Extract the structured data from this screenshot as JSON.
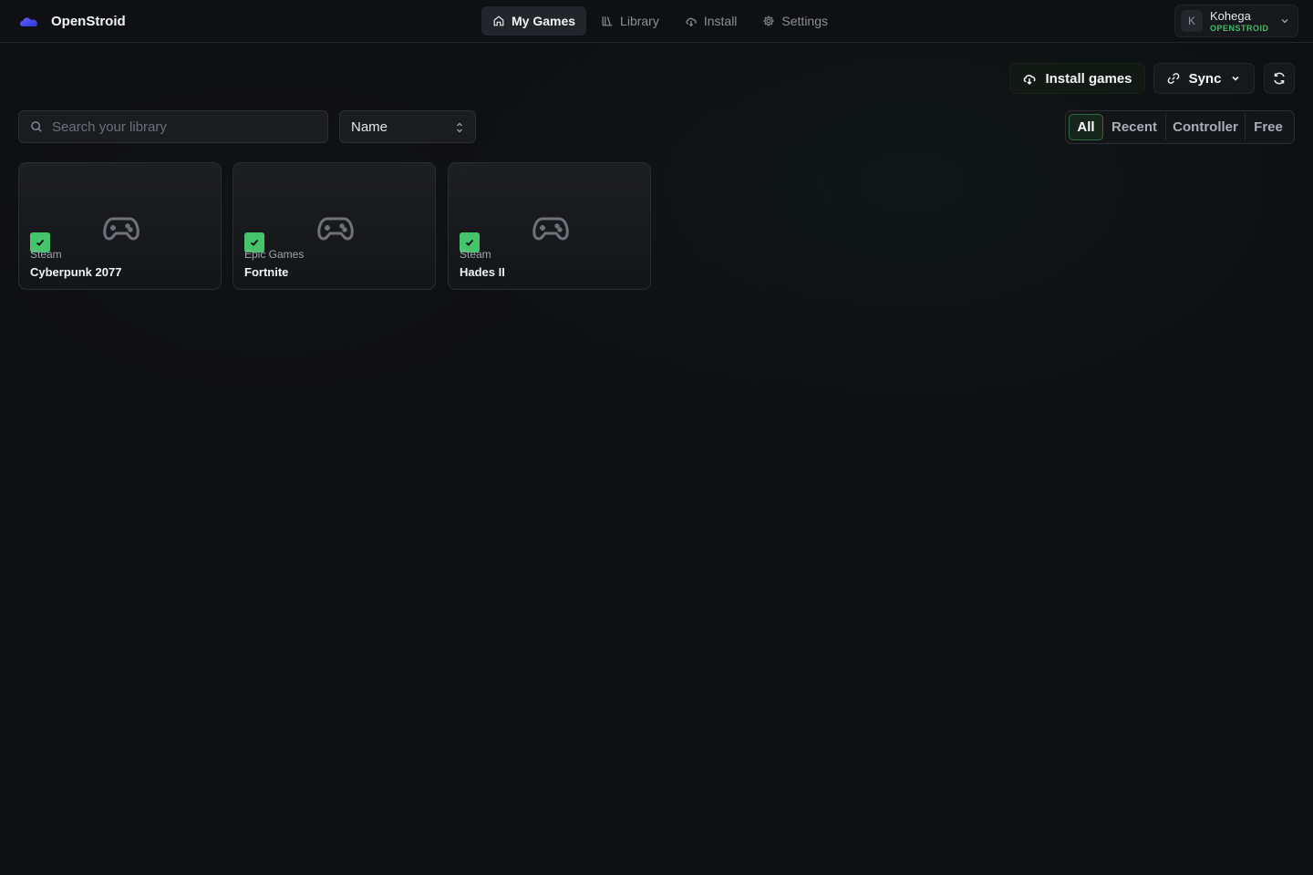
{
  "app": {
    "name": "OpenStroid"
  },
  "nav": {
    "items": [
      {
        "label": "My Games",
        "icon": "home-icon",
        "active": true
      },
      {
        "label": "Library",
        "icon": "library-icon",
        "active": false
      },
      {
        "label": "Install",
        "icon": "cloud-download-icon",
        "active": false
      },
      {
        "label": "Settings",
        "icon": "gear-icon",
        "active": false
      }
    ]
  },
  "user": {
    "initial": "K",
    "name": "Kohega",
    "tier": "OPENSTROID"
  },
  "actions": {
    "install_label": "Install games",
    "sync_label": "Sync"
  },
  "search": {
    "placeholder": "Search your library",
    "value": ""
  },
  "sort": {
    "selected": "Name"
  },
  "filters": [
    {
      "label": "All",
      "active": true
    },
    {
      "label": "Recent",
      "active": false
    },
    {
      "label": "Controller",
      "active": false
    },
    {
      "label": "Free",
      "active": false
    }
  ],
  "games": [
    {
      "title": "Cyberpunk 2077",
      "platform": "Steam",
      "installed": true
    },
    {
      "title": "Fortnite",
      "platform": "Epic Games",
      "installed": true
    },
    {
      "title": "Hades II",
      "platform": "Steam",
      "installed": true
    }
  ],
  "colors": {
    "accent": "#46c46b",
    "background": "#0e0f12",
    "card": "#1d1e22"
  }
}
